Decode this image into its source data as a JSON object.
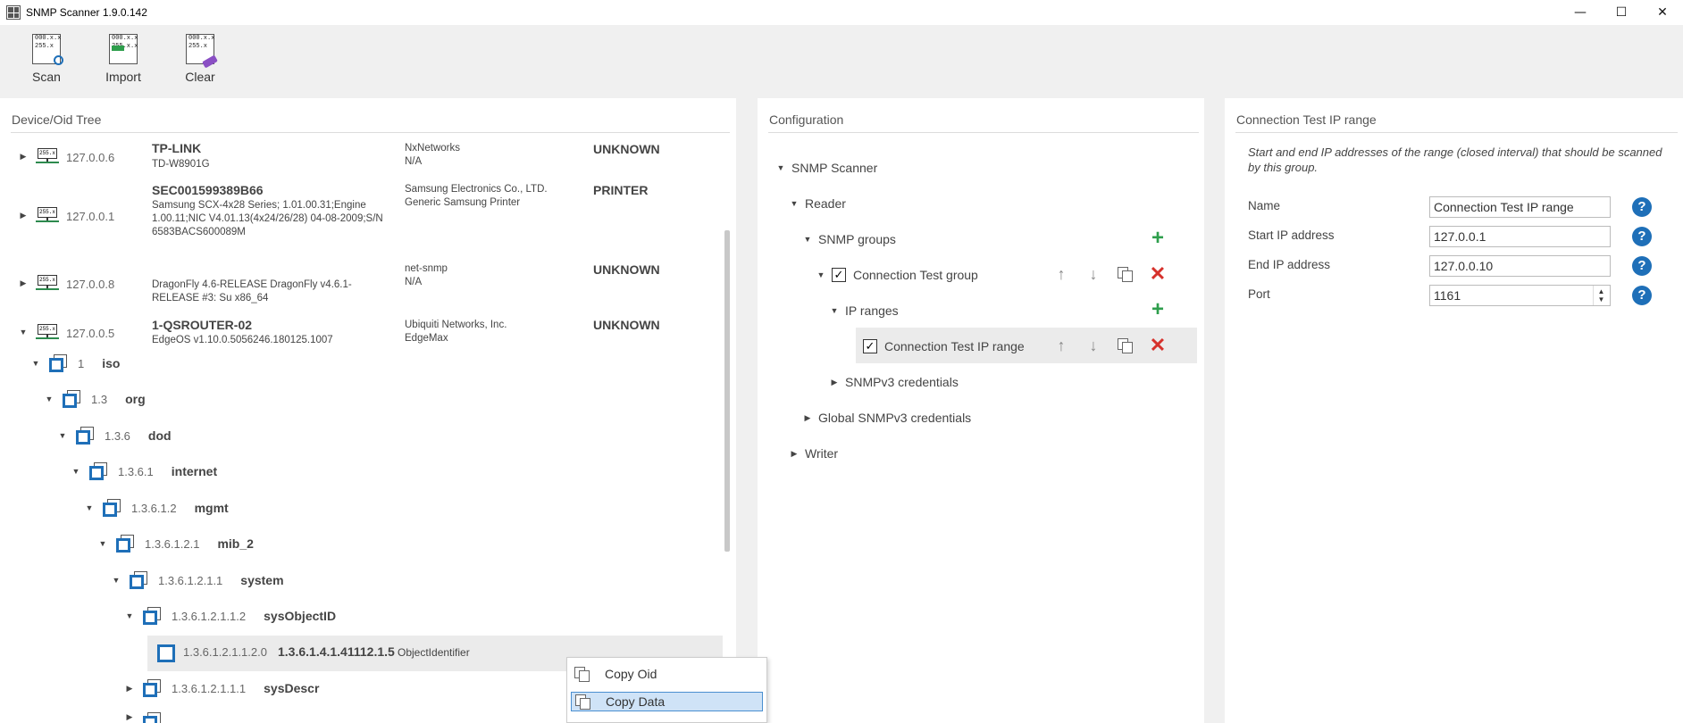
{
  "window": {
    "title": "SNMP Scanner 1.9.0.142",
    "minimize": "—",
    "maximize": "☐",
    "close": "✕"
  },
  "toolbar": {
    "buttons": [
      {
        "label": "Scan",
        "icon": "scan-icon",
        "icon_text": "000.x.x\n255.x"
      },
      {
        "label": "Import",
        "icon": "import-icon",
        "icon_text": "000.x.x\n255.x.x"
      },
      {
        "label": "Clear",
        "icon": "clear-icon",
        "icon_text": "000.x.x\n255.x"
      }
    ]
  },
  "tree_panel": {
    "title": "Device/Oid Tree",
    "device_icon_text": "255.x",
    "devices": [
      {
        "ip": "127.0.0.6",
        "name": "TP-LINK",
        "desc": "TD-W8901G",
        "vendor": "NxNetworks",
        "model": "N/A",
        "type": "UNKNOWN",
        "expanded": false
      },
      {
        "ip": "127.0.0.1",
        "name": "SEC001599389B66",
        "desc": "Samsung SCX-4x28 Series; 1.01.00.31;Engine 1.00.11;NIC V4.01.13(4x24/26/28) 04-08-2009;S/N 6583BACS600089M",
        "vendor": "Samsung Electronics Co., LTD.",
        "model": "Generic Samsung Printer",
        "type": "PRINTER",
        "expanded": false
      },
      {
        "ip": "127.0.0.8",
        "name": "",
        "desc": "DragonFly 4.6-RELEASE DragonFly v4.6.1-RELEASE #3: Su x86_64",
        "vendor": "net-snmp",
        "model": "N/A",
        "type": "UNKNOWN",
        "expanded": false
      },
      {
        "ip": "127.0.0.5",
        "name": "1-QSROUTER-02",
        "desc": "EdgeOS v1.10.0.5056246.180125.1007",
        "vendor": "Ubiquiti Networks, Inc.",
        "model": "EdgeMax",
        "type": "UNKNOWN",
        "expanded": true
      }
    ],
    "oids": [
      {
        "num": "1",
        "name": "iso"
      },
      {
        "num": "1.3",
        "name": "org"
      },
      {
        "num": "1.3.6",
        "name": "dod"
      },
      {
        "num": "1.3.6.1",
        "name": "internet"
      },
      {
        "num": "1.3.6.1.2",
        "name": "mgmt"
      },
      {
        "num": "1.3.6.1.2.1",
        "name": "mib_2"
      },
      {
        "num": "1.3.6.1.2.1.1",
        "name": "system"
      },
      {
        "num": "1.3.6.1.2.1.1.2",
        "name": "sysObjectID"
      }
    ],
    "leaf": {
      "num": "1.3.6.1.2.1.1.2.0",
      "value": "1.3.6.1.4.1.41112.1.5",
      "type": "ObjectIdentifier"
    },
    "after_leaf": {
      "num": "1.3.6.1.2.1.1.1",
      "name": "sysDescr"
    }
  },
  "context_menu": {
    "items": [
      "Copy Oid",
      "Copy Data"
    ],
    "highlighted": "Copy Data"
  },
  "config_panel": {
    "title": "Configuration",
    "nodes": {
      "root": "SNMP Scanner",
      "reader": "Reader",
      "snmp_groups": "SNMP groups",
      "group": "Connection Test group",
      "ip_ranges": "IP ranges",
      "range": "Connection Test IP range",
      "snmpv3": "SNMPv3 credentials",
      "global_snmpv3": "Global SNMPv3 credentials",
      "writer": "Writer"
    }
  },
  "props_panel": {
    "title": "Connection Test IP range",
    "description": "Start and end IP addresses of the range (closed interval) that should be scanned by this group.",
    "fields": {
      "name": {
        "label": "Name",
        "value": "Connection Test IP range"
      },
      "start_ip": {
        "label": "Start IP address",
        "value": "127.0.0.1"
      },
      "end_ip": {
        "label": "End IP address",
        "value": "127.0.0.10"
      },
      "port": {
        "label": "Port",
        "value": "1161"
      }
    },
    "help_glyph": "?"
  },
  "colors": {
    "accent_blue": "#1e6fb8",
    "add_green": "#2e9e4c",
    "delete_red": "#d6312b",
    "selection": "#cfe3f7"
  }
}
